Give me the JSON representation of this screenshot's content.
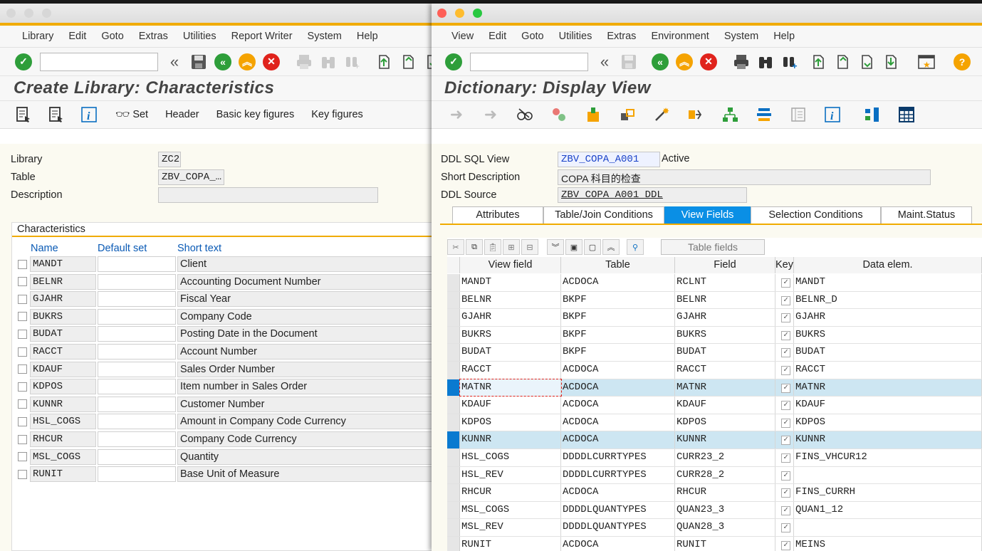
{
  "left_window": {
    "menu": [
      "Library",
      "Edit",
      "Goto",
      "Extras",
      "Utilities",
      "Report Writer",
      "System",
      "Help"
    ],
    "page_title": "Create Library: Characteristics",
    "app_toolbar": {
      "set_label": "Set",
      "header_label": "Header",
      "basic_kf_label": "Basic key figures",
      "kf_label": "Key figures"
    },
    "fields": {
      "library_label": "Library",
      "library_value": "ZC2",
      "table_label": "Table",
      "table_value": "ZBV_COPA_…",
      "description_label": "Description",
      "description_value": ""
    },
    "characteristics": {
      "title": "Characteristics",
      "headers": {
        "name": "Name",
        "default_set": "Default set",
        "short_text": "Short text"
      },
      "rows": [
        {
          "name": "MANDT",
          "short": "Client"
        },
        {
          "name": "BELNR",
          "short": "Accounting Document Number"
        },
        {
          "name": "GJAHR",
          "short": "Fiscal Year"
        },
        {
          "name": "BUKRS",
          "short": "Company Code"
        },
        {
          "name": "BUDAT",
          "short": "Posting Date in the Document"
        },
        {
          "name": "RACCT",
          "short": "Account Number"
        },
        {
          "name": "KDAUF",
          "short": "Sales Order Number"
        },
        {
          "name": "KDPOS",
          "short": "Item number in Sales Order"
        },
        {
          "name": "KUNNR",
          "short": "Customer Number"
        },
        {
          "name": "HSL_COGS",
          "short": "Amount in Company Code Currency"
        },
        {
          "name": "RHCUR",
          "short": "Company Code Currency"
        },
        {
          "name": "MSL_COGS",
          "short": "Quantity"
        },
        {
          "name": "RUNIT",
          "short": "Base Unit of Measure"
        }
      ]
    }
  },
  "right_window": {
    "menu": [
      "View",
      "Edit",
      "Goto",
      "Utilities",
      "Extras",
      "Environment",
      "System",
      "Help"
    ],
    "page_title": "Dictionary: Display View",
    "fields": {
      "ddl_sql_view_label": "DDL SQL View",
      "ddl_sql_view_value": "ZBV_COPA_A001",
      "status": "Active",
      "short_desc_label": "Short Description",
      "short_desc_value": "COPA 科目的检查",
      "ddl_source_label": "DDL Source",
      "ddl_source_value": "ZBV_COPA_A001_DDL"
    },
    "tabs": [
      "Attributes",
      "Table/Join Conditions",
      "View Fields",
      "Selection Conditions",
      "Maint.Status"
    ],
    "active_tab": "View Fields",
    "table_fields_button": "Table fields",
    "grid_headers": {
      "view_field": "View field",
      "table": "Table",
      "field": "Field",
      "key": "Key",
      "data_elem": "Data elem."
    },
    "rows": [
      {
        "vf": "MANDT",
        "table": "ACDOCA",
        "field": "RCLNT",
        "key": "✓",
        "de": "MANDT",
        "sel": false
      },
      {
        "vf": "BELNR",
        "table": "BKPF",
        "field": "BELNR",
        "key": "✓",
        "de": "BELNR_D",
        "sel": false
      },
      {
        "vf": "GJAHR",
        "table": "BKPF",
        "field": "GJAHR",
        "key": "✓",
        "de": "GJAHR",
        "sel": false
      },
      {
        "vf": "BUKRS",
        "table": "BKPF",
        "field": "BUKRS",
        "key": "✓",
        "de": "BUKRS",
        "sel": false
      },
      {
        "vf": "BUDAT",
        "table": "BKPF",
        "field": "BUDAT",
        "key": "✓",
        "de": "BUDAT",
        "sel": false
      },
      {
        "vf": "RACCT",
        "table": "ACDOCA",
        "field": "RACCT",
        "key": "✓",
        "de": "RACCT",
        "sel": false
      },
      {
        "vf": "MATNR",
        "table": "ACDOCA",
        "field": "MATNR",
        "key": "✓",
        "de": "MATNR",
        "sel": true
      },
      {
        "vf": "KDAUF",
        "table": "ACDOCA",
        "field": "KDAUF",
        "key": "✓",
        "de": "KDAUF",
        "sel": false
      },
      {
        "vf": "KDPOS",
        "table": "ACDOCA",
        "field": "KDPOS",
        "key": "✓",
        "de": "KDPOS",
        "sel": false
      },
      {
        "vf": "KUNNR",
        "table": "ACDOCA",
        "field": "KUNNR",
        "key": "✓",
        "de": "KUNNR",
        "sel": true
      },
      {
        "vf": "HSL_COGS",
        "table": "DDDDLCURRTYPES",
        "field": "CURR23_2",
        "key": "✓",
        "de": "FINS_VHCUR12",
        "sel": false
      },
      {
        "vf": "HSL_REV",
        "table": "DDDDLCURRTYPES",
        "field": "CURR28_2",
        "key": "✓",
        "de": "",
        "sel": false
      },
      {
        "vf": "RHCUR",
        "table": "ACDOCA",
        "field": "RHCUR",
        "key": "✓",
        "de": "FINS_CURRH",
        "sel": false
      },
      {
        "vf": "MSL_COGS",
        "table": "DDDDLQUANTYPES",
        "field": "QUAN23_3",
        "key": "✓",
        "de": "QUAN1_12",
        "sel": false
      },
      {
        "vf": "MSL_REV",
        "table": "DDDDLQUANTYPES",
        "field": "QUAN28_3",
        "key": "✓",
        "de": "",
        "sel": false
      },
      {
        "vf": "RUNIT",
        "table": "ACDOCA",
        "field": "RUNIT",
        "key": "✓",
        "de": "MEINS",
        "sel": false
      }
    ]
  },
  "colors": {
    "sap_gold": "#f0ab00",
    "accent_blue": "#0a8fe5",
    "selected_row": "#cde6f2",
    "link_blue": "#0a5ab5"
  }
}
